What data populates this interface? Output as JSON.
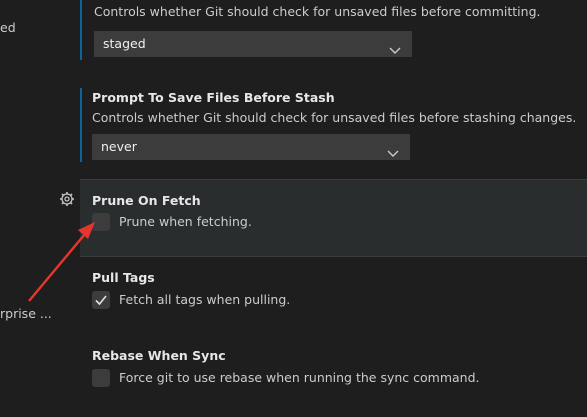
{
  "sidebar": {
    "fragment_top": "ed",
    "fragment_bottom": "rprise ..."
  },
  "settings": {
    "confirm_commit": {
      "description": "Controls whether Git should check for unsaved files before committing.",
      "value": "staged"
    },
    "prompt_save_stash": {
      "title": "Prompt To Save Files Before Stash",
      "description": "Controls whether Git should check for unsaved files before stashing changes.",
      "value": "never"
    },
    "prune_on_fetch": {
      "title": "Prune On Fetch",
      "label": "Prune when fetching.",
      "checked": false
    },
    "pull_tags": {
      "title": "Pull Tags",
      "label": "Fetch all tags when pulling.",
      "checked": true
    },
    "rebase_when_sync": {
      "title": "Rebase When Sync",
      "label": "Force git to use rebase when running the sync command.",
      "checked": false
    }
  },
  "colors": {
    "background": "#1e1e1e",
    "modified_indicator": "#0e639c",
    "annotation_arrow": "#e8352d"
  },
  "icons": {
    "gear": "gear-icon",
    "chevron": "chevron-down-icon",
    "check": "checkmark-icon"
  }
}
